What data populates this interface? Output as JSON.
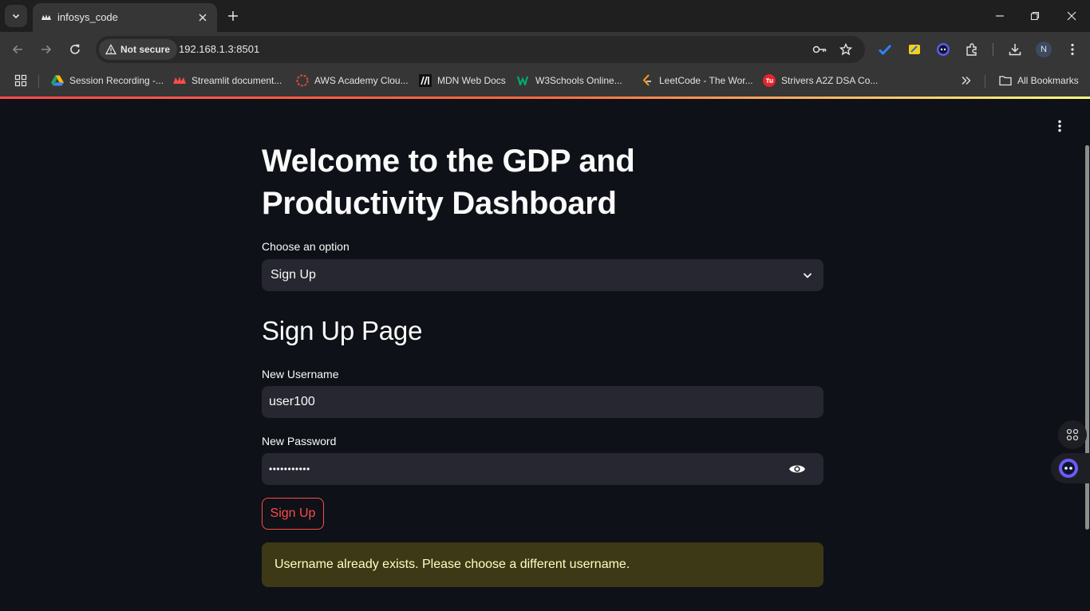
{
  "browser": {
    "tab_title": "infosys_code",
    "security_label": "Not secure",
    "url": "192.168.1.3:8501",
    "profile_initial": "N"
  },
  "bookmarks": [
    {
      "label": "Session Recording -...",
      "icon": "google-drive-icon"
    },
    {
      "label": "Streamlit document...",
      "icon": "streamlit-icon"
    },
    {
      "label": "AWS Academy Clou...",
      "icon": "aws-academy-icon"
    },
    {
      "label": "MDN Web Docs",
      "icon": "mdn-icon"
    },
    {
      "label": "W3Schools Online...",
      "icon": "w3schools-icon"
    },
    {
      "label": "LeetCode - The Wor...",
      "icon": "leetcode-icon"
    },
    {
      "label": "Strivers A2Z DSA Co...",
      "icon": "tuf-icon"
    }
  ],
  "all_bookmarks_label": "All Bookmarks",
  "colors": {
    "accent": "#ff4b4b",
    "background": "#0e1117",
    "field": "#262730",
    "warning_bg": "#3d3916",
    "warning_text": "#ffffc2"
  },
  "app": {
    "title": "Welcome to the GDP and Productivity Dashboard",
    "choose_label": "Choose an option",
    "choose_value": "Sign Up",
    "subheader": "Sign Up Page",
    "username_label": "New Username",
    "username_value": "user100",
    "password_label": "New Password",
    "password_value": "•••••••••••",
    "submit_label": "Sign Up",
    "warning": "Username already exists. Please choose a different username."
  }
}
